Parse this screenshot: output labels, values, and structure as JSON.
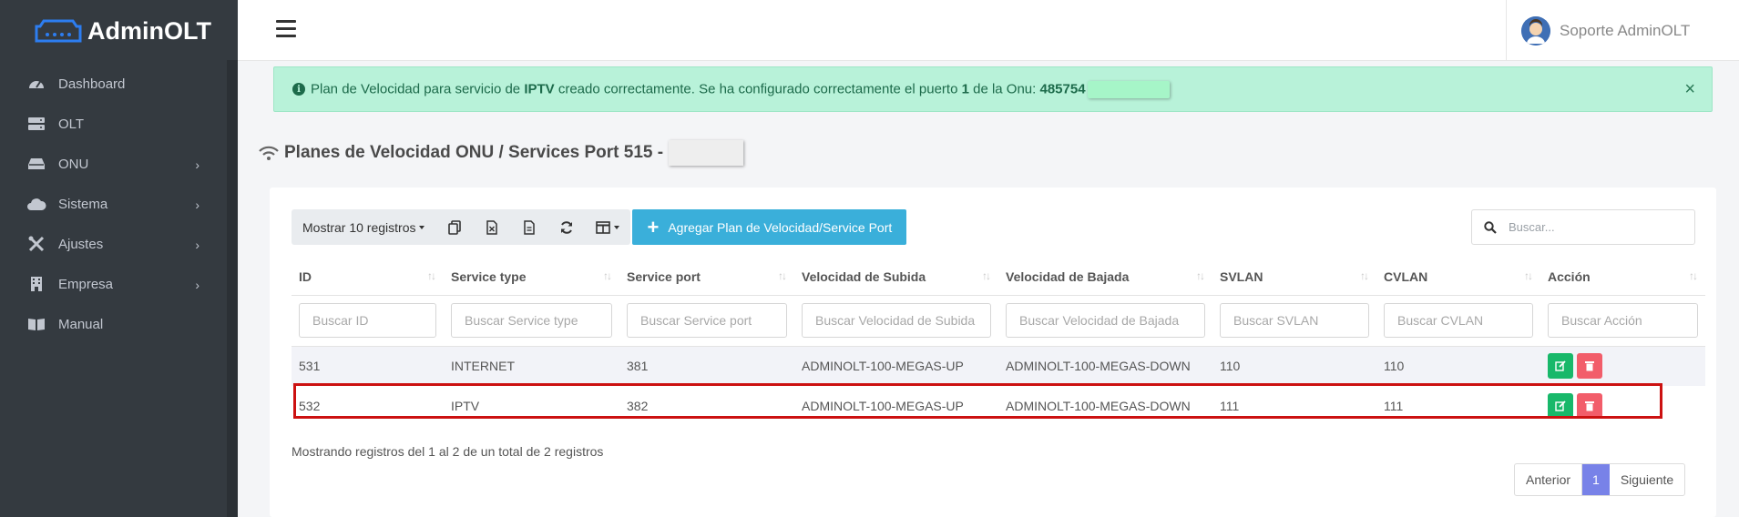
{
  "brand": {
    "name": "AdminOLT"
  },
  "sidebar": {
    "items": [
      {
        "label": "Dashboard",
        "icon": "dashboard-icon",
        "submenu": false
      },
      {
        "label": "OLT",
        "icon": "server-icon",
        "submenu": false
      },
      {
        "label": "ONU",
        "icon": "hdd-icon",
        "submenu": true
      },
      {
        "label": "Sistema",
        "icon": "cloud-icon",
        "submenu": true
      },
      {
        "label": "Ajustes",
        "icon": "tools-icon",
        "submenu": true
      },
      {
        "label": "Empresa",
        "icon": "building-icon",
        "submenu": true
      },
      {
        "label": "Manual",
        "icon": "book-icon",
        "submenu": false
      }
    ]
  },
  "topbar": {
    "user_name": "Soporte AdminOLT"
  },
  "alert": {
    "part1": "Plan de Velocidad para servicio de ",
    "bold1": "IPTV",
    "part2": " creado correctamente. Se ha configurado correctamente el puerto ",
    "bold2": "1",
    "part3": " de la Onu: ",
    "bold3": "485754",
    "close": "×"
  },
  "page": {
    "title": "Planes de Velocidad ONU / Services Port 515 -"
  },
  "toolbar": {
    "show_label": "Mostrar 10 registros",
    "add_label": "Agregar Plan de Velocidad/Service Port"
  },
  "search": {
    "placeholder": "Buscar..."
  },
  "table": {
    "headers": [
      "ID",
      "Service type",
      "Service port",
      "Velocidad de Subida",
      "Velocidad de Bajada",
      "SVLAN",
      "CVLAN",
      "Acción"
    ],
    "filters": [
      "Buscar ID",
      "Buscar Service type",
      "Buscar Service port",
      "Buscar Velocidad de Subida",
      "Buscar Velocidad de Bajada",
      "Buscar SVLAN",
      "Buscar CVLAN",
      "Buscar Acción"
    ],
    "rows": [
      [
        "531",
        "INTERNET",
        "381",
        "ADMINOLT-100-MEGAS-UP",
        "ADMINOLT-100-MEGAS-DOWN",
        "110",
        "110"
      ],
      [
        "532",
        "IPTV",
        "382",
        "ADMINOLT-100-MEGAS-UP",
        "ADMINOLT-100-MEGAS-DOWN",
        "111",
        "111"
      ]
    ]
  },
  "footer": {
    "info": "Mostrando registros del 1 al 2 de un total de 2 registros",
    "prev": "Anterior",
    "current": "1",
    "next": "Siguiente"
  },
  "colors": {
    "sidebar": "#343a40",
    "accent": "#3aafda",
    "success": "#18b86a",
    "danger": "#f25d6a",
    "alert_bg": "#b8f2d9",
    "page_active": "#7882e8"
  }
}
